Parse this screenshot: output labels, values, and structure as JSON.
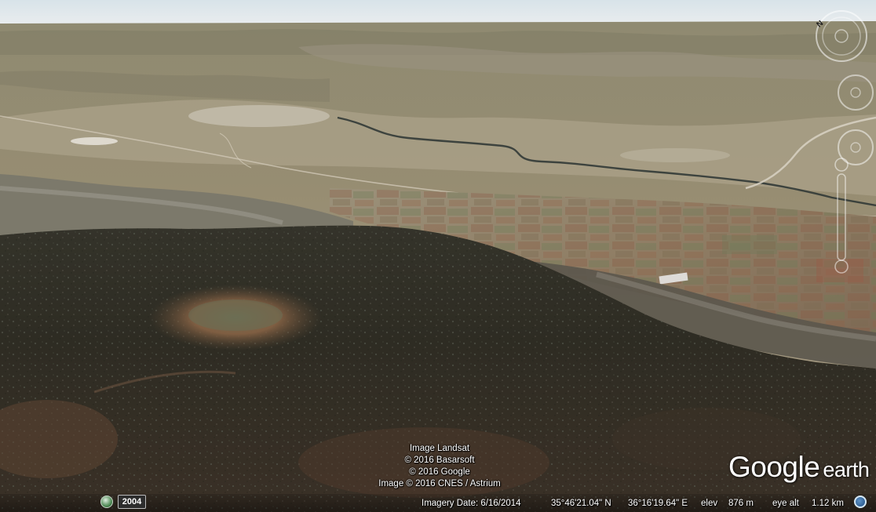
{
  "attribution": {
    "lines": [
      "Image Landsat",
      "© 2016 Basarsoft",
      "© 2016 Google",
      "Image © 2016 CNES / Astrium"
    ]
  },
  "brand": {
    "primary": "Google",
    "secondary": "earth"
  },
  "status": {
    "historical_year": "2004",
    "imagery_date": "Imagery Date: 6/16/2014",
    "latitude": "35°46'21.04\" N",
    "longitude": "36°16'19.64\" E",
    "elev_label": "elev",
    "elev_value": "876 m",
    "eye_alt_label": "eye alt",
    "eye_alt_value": "1.12 km"
  },
  "navigation": {
    "compass_letter": "N"
  },
  "icons": {
    "history": "clock-history-icon",
    "globe": "globe-icon",
    "compass": "compass-icon",
    "look": "look-joystick-icon",
    "move": "move-joystick-icon",
    "zoom": "zoom-slider-icon"
  },
  "colors": {
    "sky": "#dfe6ea",
    "far_terrain": "#8c8569",
    "valley": "#a59b80",
    "fields_red": "#8c5b43",
    "river": "#2a3433",
    "dark_hill": "#2b2a21",
    "reddish_clearing": "#8a5a3c"
  }
}
